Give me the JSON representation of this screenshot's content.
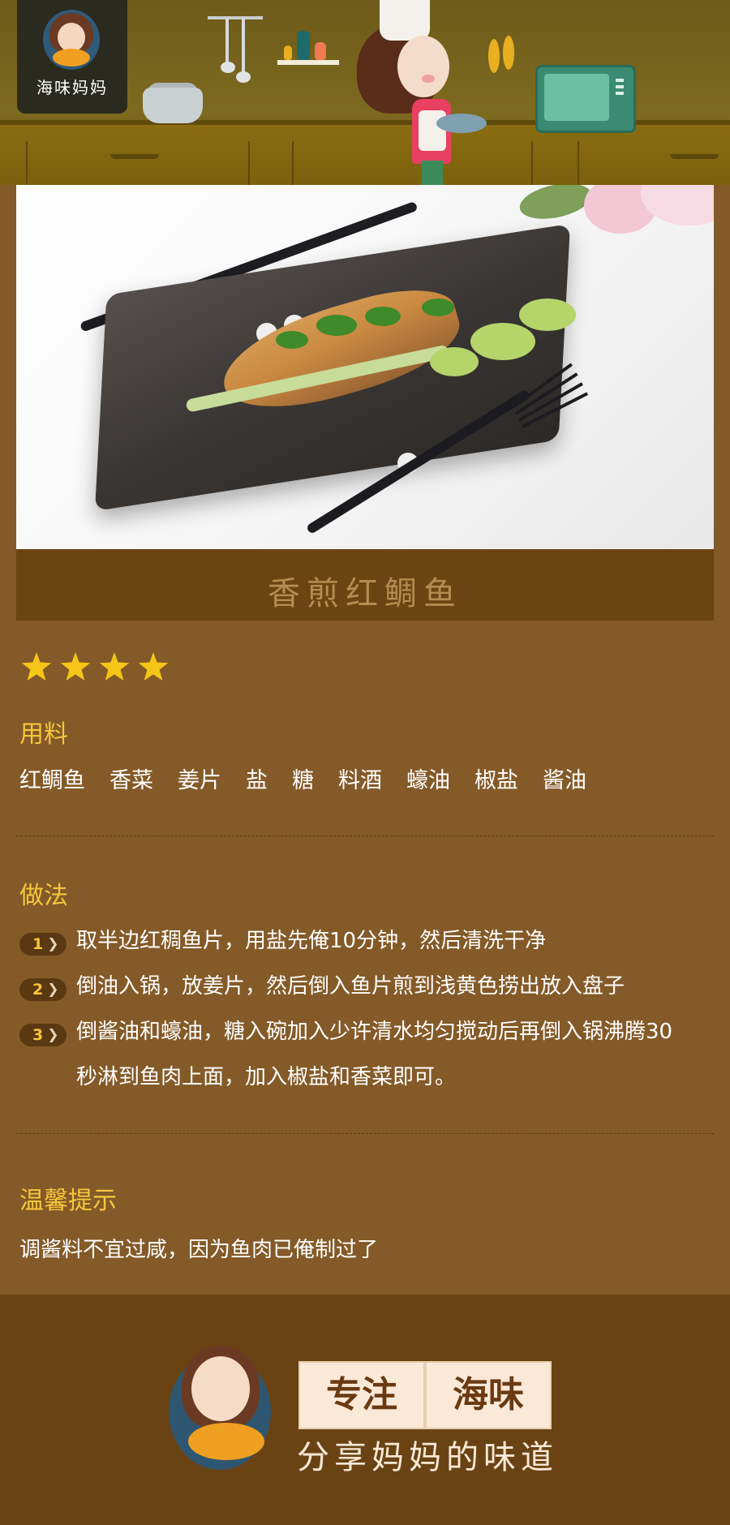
{
  "header": {
    "logo_text": "海味妈妈"
  },
  "dish": {
    "title": "香煎红鲷鱼",
    "rating": 4
  },
  "ingredients": {
    "title": "用料",
    "items": [
      "红鲷鱼",
      "香菜",
      "姜片",
      "盐",
      "糖",
      "料酒",
      "蠔油",
      "椒盐",
      "酱油"
    ]
  },
  "method": {
    "title": "做法",
    "steps": [
      {
        "num": "1",
        "text": "取半边红稠鱼片，用盐先俺10分钟，然后清洗干净"
      },
      {
        "num": "2",
        "text": "倒油入锅，放姜片，然后倒入鱼片煎到浅黄色捞出放入盘子"
      },
      {
        "num": "3",
        "text": "倒酱油和蠔油，糖入碗加入少许清水均匀搅动后再倒入锅沸腾30秒淋到鱼肉上面，加入椒盐和香菜即可。"
      }
    ]
  },
  "tips": {
    "title": "温馨提示",
    "text": "调酱料不宜过咸，因为鱼肉已俺制过了"
  },
  "footer": {
    "box_left": "专注",
    "box_right": "海味",
    "slogan": "分享妈妈的味道"
  },
  "colors": {
    "background": "#845a28",
    "accent": "#f7c63c",
    "title_bar": "#6b4413",
    "footer": "#6a4314"
  }
}
